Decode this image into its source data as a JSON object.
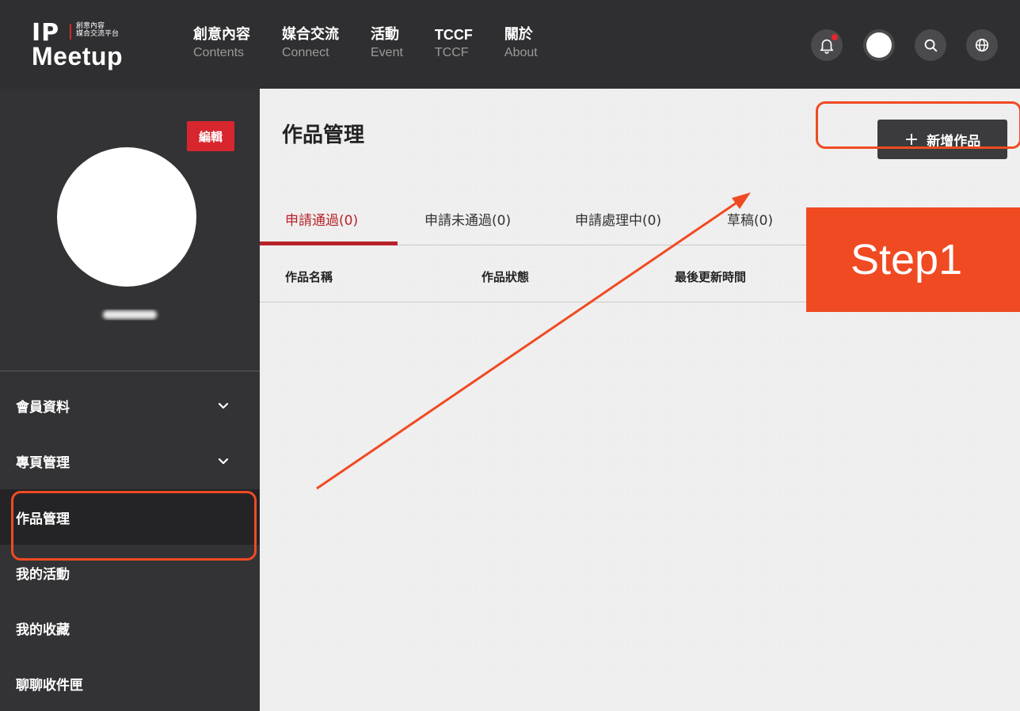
{
  "header": {
    "logo": {
      "ip": "IP",
      "small_line1": "創意內容",
      "small_line2": "媒合交流平台",
      "meetup": "Meetup"
    },
    "nav": [
      {
        "zh": "創意內容",
        "en": "Contents"
      },
      {
        "zh": "媒合交流",
        "en": "Connect"
      },
      {
        "zh": "活動",
        "en": "Event"
      },
      {
        "zh": "TCCF",
        "en": "TCCF"
      },
      {
        "zh": "關於",
        "en": "About"
      }
    ],
    "tools": [
      "bell-icon",
      "avatar",
      "search-icon",
      "globe-icon"
    ]
  },
  "sidebar": {
    "edit_label": "編輯",
    "menu": [
      {
        "label": "會員資料",
        "expandable": true
      },
      {
        "label": "專頁管理",
        "expandable": true
      },
      {
        "label": "作品管理",
        "active": true
      },
      {
        "label": "我的活動"
      },
      {
        "label": "我的收藏"
      },
      {
        "label": "聊聊收件匣"
      }
    ]
  },
  "main": {
    "title": "作品管理",
    "add_button": {
      "icon": "+",
      "label": "新增作品"
    },
    "tabs": [
      {
        "label": "申請通過(0)",
        "active": true
      },
      {
        "label": "申請未通過(0)"
      },
      {
        "label": "申請處理中(0)"
      },
      {
        "label": "草稿(0)"
      }
    ],
    "columns": [
      "作品名稱",
      "作品狀態",
      "最後更新時間"
    ]
  },
  "annotation": {
    "step_label": "Step1",
    "color": "#f04a22"
  },
  "colors": {
    "brand_red": "#d7262e",
    "active_tab": "#b8232a",
    "dark_bg": "#2f2f31"
  }
}
